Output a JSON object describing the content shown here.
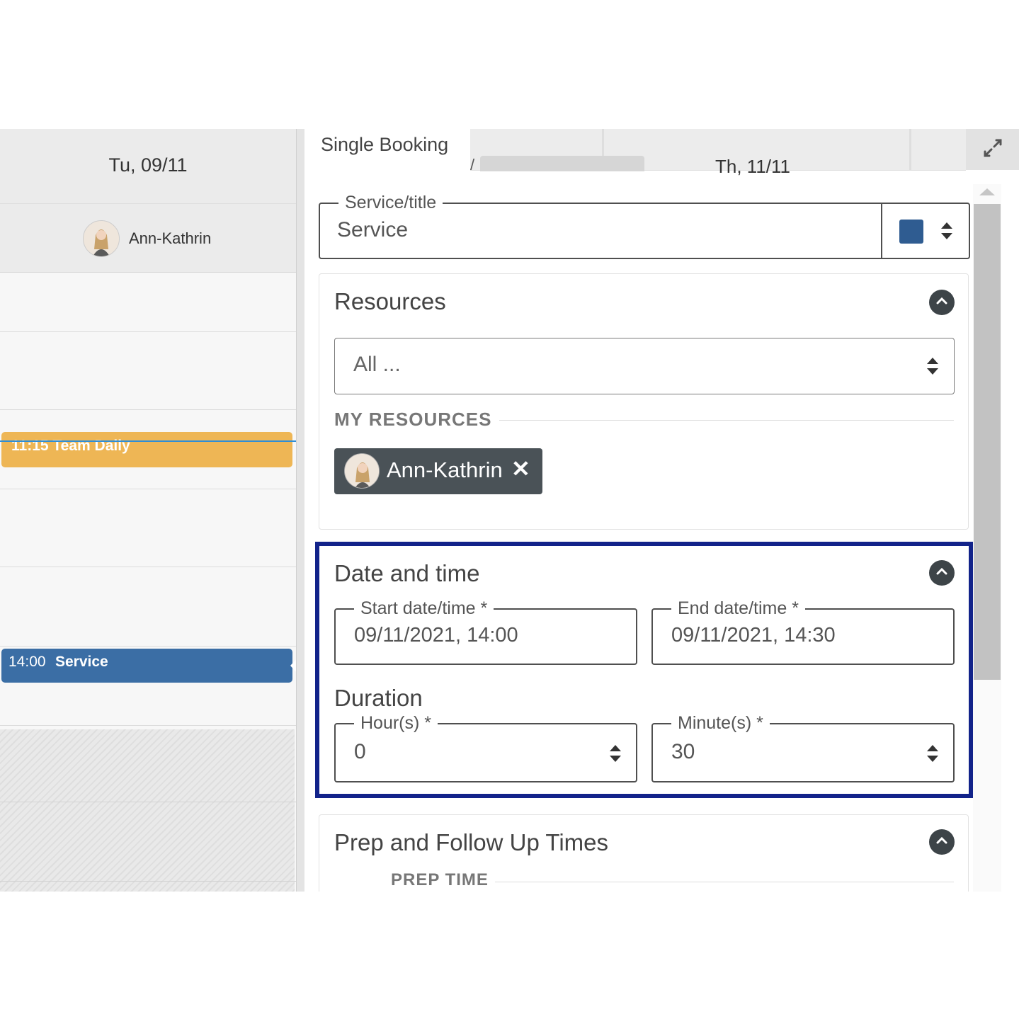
{
  "calendar": {
    "day_header": "Tu, 09/11",
    "resource_name": "Ann-Kathrin",
    "events": [
      {
        "time": "11:15",
        "title": "Team Daily",
        "color": "#eeb655"
      },
      {
        "time": "14:00",
        "title": "Service",
        "color": "#3b6ea5"
      }
    ]
  },
  "panel": {
    "tab_label": "Single Booking",
    "background_tab_text": "Th, 11/11",
    "expand_icon": "expand-arrows-icon",
    "service": {
      "legend": "Service/title",
      "value": "Service",
      "color": "#2f5c91"
    },
    "resources": {
      "title": "Resources",
      "select_value": "All ...",
      "my_resources_label": "MY RESOURCES",
      "chips": [
        {
          "name": "Ann-Kathrin",
          "remove_glyph": "✕"
        }
      ]
    },
    "date_time": {
      "title": "Date and time",
      "start_legend": "Start date/time *",
      "start_value": "09/11/2021, 14:00",
      "end_legend": "End date/time *",
      "end_value": "09/11/2021, 14:30",
      "duration_title": "Duration",
      "hours_legend": "Hour(s) *",
      "hours_value": "0",
      "minutes_legend": "Minute(s) *",
      "minutes_value": "30",
      "highlight_color": "#12238a"
    },
    "prep": {
      "title": "Prep and Follow Up Times",
      "prep_time_label": "PREP TIME"
    }
  }
}
